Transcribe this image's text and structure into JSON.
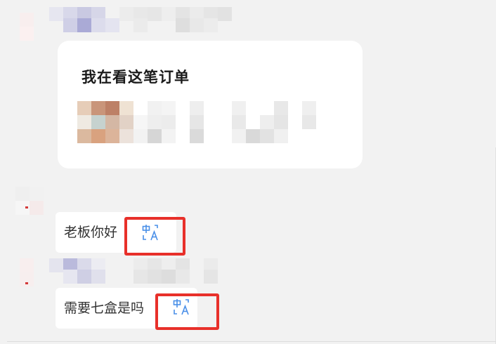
{
  "order_card": {
    "title": "我在看这笔订单"
  },
  "messages": [
    {
      "text": "老板你好",
      "translate_icon": "translate-icon"
    },
    {
      "text": "需要七盒是吗",
      "translate_icon": "translate-icon"
    }
  ],
  "colors": {
    "background": "#f2f2f2",
    "bubble": "#ffffff",
    "text": "#333333",
    "translate_icon": "#4a8fe8",
    "highlight": "#e8302a"
  }
}
